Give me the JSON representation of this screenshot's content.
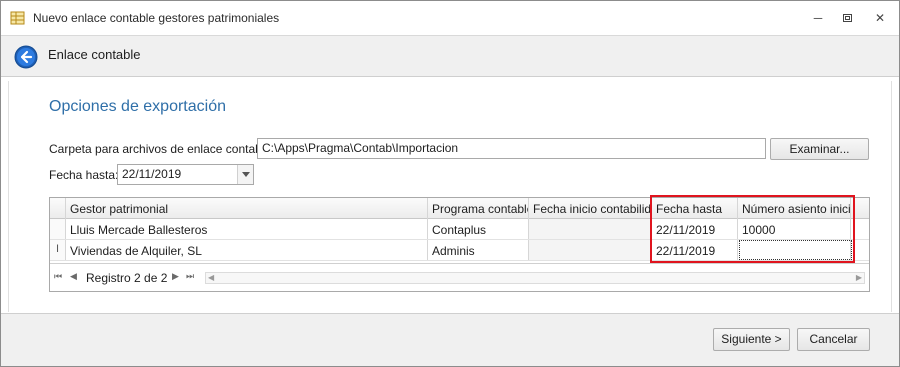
{
  "window": {
    "title": "Nuevo enlace contable gestores patrimoniales",
    "minimize_glyph": "─",
    "restore_glyph": "▫",
    "close_glyph": "✕"
  },
  "header": {
    "title": "Enlace contable",
    "back_icon": "back-arrow-icon"
  },
  "section": {
    "title": "Opciones de exportación"
  },
  "folder": {
    "label": "Carpeta para archivos de enlace contable:",
    "value": "C:\\Apps\\Pragma\\Contab\\Importacion",
    "browse_label": "Examinar..."
  },
  "date_to": {
    "label": "Fecha hasta:",
    "value": "22/11/2019"
  },
  "grid": {
    "columns": [
      "Gestor patrimonial",
      "Programa contable",
      "Fecha inicio contabilidad",
      "Fecha hasta",
      "Número asiento inicial"
    ],
    "rows": [
      {
        "gestor": "Lluis Mercade Ballesteros",
        "programa": "Contaplus",
        "fecha_inicio": "",
        "fecha_hasta": "22/11/2019",
        "asiento": "10000",
        "marker": ""
      },
      {
        "gestor": "Viviendas de Alquiler, SL",
        "programa": "Adminis",
        "fecha_inicio": "",
        "fecha_hasta": "22/11/2019",
        "asiento": "",
        "marker": "I"
      }
    ],
    "navigator": {
      "text": "Registro 2 de 2",
      "first": "⏮",
      "prev": "◀",
      "next": "▶",
      "last": "⏭",
      "scroll_left": "◀",
      "scroll_right": "▶"
    },
    "highlight_color": "#e0141e"
  },
  "footer": {
    "next_label": "Siguiente >",
    "cancel_label": "Cancelar"
  },
  "colors": {
    "accent": "#2f6fa8",
    "highlight": "#e0141e"
  }
}
